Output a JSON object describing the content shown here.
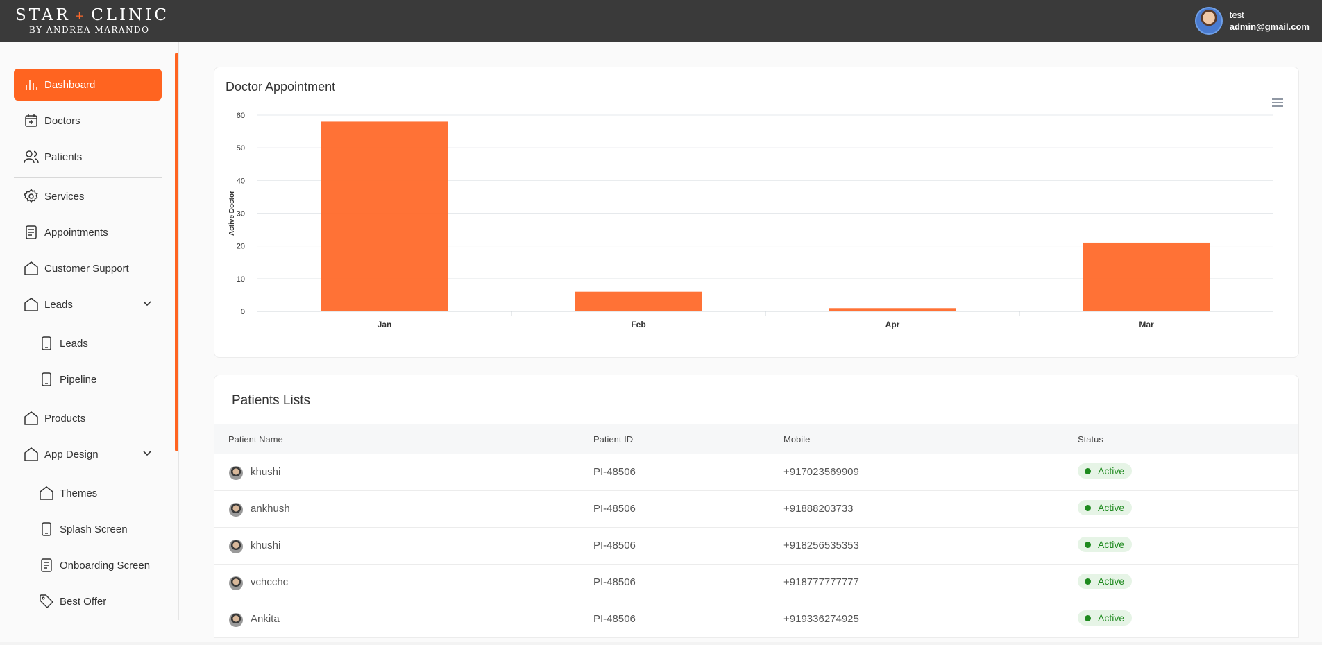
{
  "header": {
    "logo_main_left": "STAR",
    "logo_plus": "+",
    "logo_main_right": "CLINIC",
    "logo_sub": "BY ANDREA MARANDO",
    "user_name": "test",
    "user_email": "admin@gmail.com"
  },
  "sidebar": {
    "items": [
      {
        "label": "Dashboard",
        "icon": "bar-chart-icon"
      },
      {
        "label": "Doctors",
        "icon": "calendar-plus-icon"
      },
      {
        "label": "Patients",
        "icon": "users-icon"
      },
      {
        "label": "Services",
        "icon": "gear-icon"
      },
      {
        "label": "Appointments",
        "icon": "document-icon"
      },
      {
        "label": "Customer Support",
        "icon": "home-icon"
      },
      {
        "label": "Leads",
        "icon": "home-icon"
      },
      {
        "label": "Leads",
        "icon": "phone-icon"
      },
      {
        "label": "Pipeline",
        "icon": "phone-icon"
      },
      {
        "label": "Products",
        "icon": "home-icon"
      },
      {
        "label": "App Design",
        "icon": "home-icon"
      },
      {
        "label": "Themes",
        "icon": "home-icon"
      },
      {
        "label": "Splash Screen",
        "icon": "phone-icon"
      },
      {
        "label": "Onboarding Screen",
        "icon": "document-icon"
      },
      {
        "label": "Best Offer",
        "icon": "tag-icon"
      }
    ],
    "accent": "#ff6420"
  },
  "chart_card": {
    "title": "Doctor Appointment"
  },
  "chart_data": {
    "type": "bar",
    "categories": [
      "Jan",
      "Feb",
      "Apr",
      "Mar"
    ],
    "values": [
      58,
      6,
      1,
      21
    ],
    "title": "",
    "xlabel": "",
    "ylabel": "Active Doctor",
    "ylim": [
      0,
      60
    ],
    "yticks": [
      0,
      10,
      20,
      30,
      40,
      50,
      60
    ],
    "grid": true,
    "color": "#ff6a2b"
  },
  "patients": {
    "title": "Patients Lists",
    "columns": [
      "Patient Name",
      "Patient ID",
      "Mobile",
      "Status"
    ],
    "rows": [
      {
        "name": "khushi",
        "id": "PI-48506",
        "mobile": "+917023569909",
        "status": "Active"
      },
      {
        "name": "ankhush",
        "id": "PI-48506",
        "mobile": "+91888203733",
        "status": "Active"
      },
      {
        "name": "khushi",
        "id": "PI-48506",
        "mobile": "+918256535353",
        "status": "Active"
      },
      {
        "name": "vchcchc",
        "id": "PI-48506",
        "mobile": "+918777777777",
        "status": "Active"
      },
      {
        "name": "Ankita",
        "id": "PI-48506",
        "mobile": "+919336274925",
        "status": "Active"
      }
    ]
  }
}
